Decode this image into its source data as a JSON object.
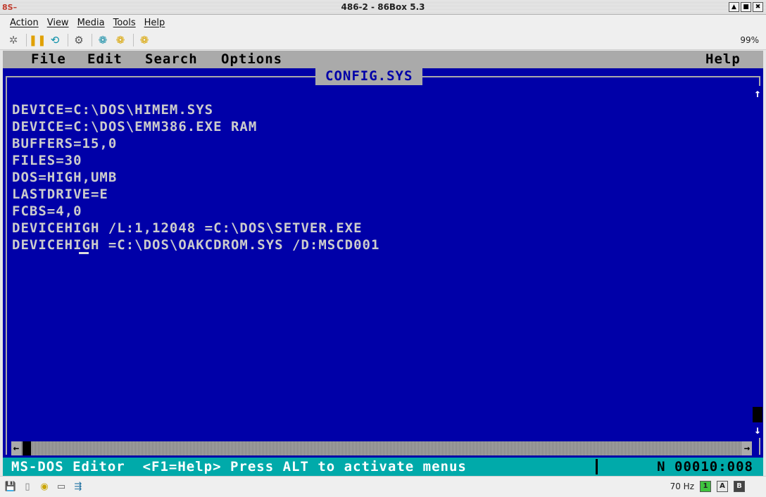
{
  "window": {
    "title": "486-2 - 86Box 5.3",
    "buttons": [
      "▲",
      "■",
      "✖"
    ]
  },
  "host_menu": [
    "Action",
    "View",
    "Media",
    "Tools",
    "Help"
  ],
  "toolbar": {
    "zoom": "99%",
    "icons": [
      "ctrl-alt-del-icon",
      "pause-icon",
      "hard-reset-icon",
      "settings-icon",
      "cd-drive-icon",
      "cd-drive-2-icon",
      "cd-drive-3-icon"
    ]
  },
  "dos": {
    "menus": [
      "File",
      "Edit",
      "Search",
      "Options"
    ],
    "help_menu": "Help",
    "file_title": "CONFIG.SYS",
    "lines": [
      "DEVICE=C:\\DOS\\HIMEM.SYS",
      "DEVICE=C:\\DOS\\EMM386.EXE RAM",
      "BUFFERS=15,0",
      "FILES=30",
      "DOS=HIGH,UMB",
      "LASTDRIVE=E",
      "FCBS=4,0",
      "DEVICEHIGH /L:1,12048 =C:\\DOS\\SETVER.EXE",
      "DEVICEHIGH =C:\\DOS\\OAKCDROM.SYS /D:MSCD001"
    ],
    "status_message": "MS-DOS Editor  <F1=Help> Press ALT to activate menus",
    "status_position": "N 00010:008",
    "scroll_up": "↑",
    "scroll_down": "↓",
    "scroll_left": "←",
    "scroll_right": "→"
  },
  "host_status": {
    "refresh": "70 Hz",
    "leds": [
      "1",
      "A",
      "B"
    ]
  },
  "colors": {
    "dos_background": "#0000a8",
    "dos_text": "#cccccc",
    "dos_menubar": "#aaaaaa",
    "dos_statusbar": "#00aaaa"
  }
}
